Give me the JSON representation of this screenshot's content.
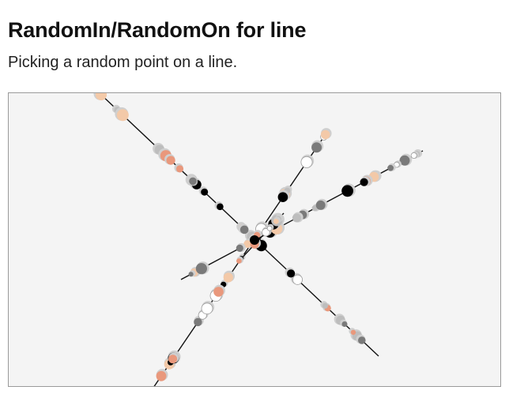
{
  "header": {
    "title": "RandomIn/RandomOn for line",
    "subtitle": "Picking a random point on a line."
  },
  "canvas": {
    "background": "#f4f4f4",
    "line_color": "#111111",
    "palette": [
      "#ffffff",
      "#f3c9a8",
      "#e9987c",
      "#bdbdbd",
      "#7a7a7a",
      "#000000"
    ]
  }
}
